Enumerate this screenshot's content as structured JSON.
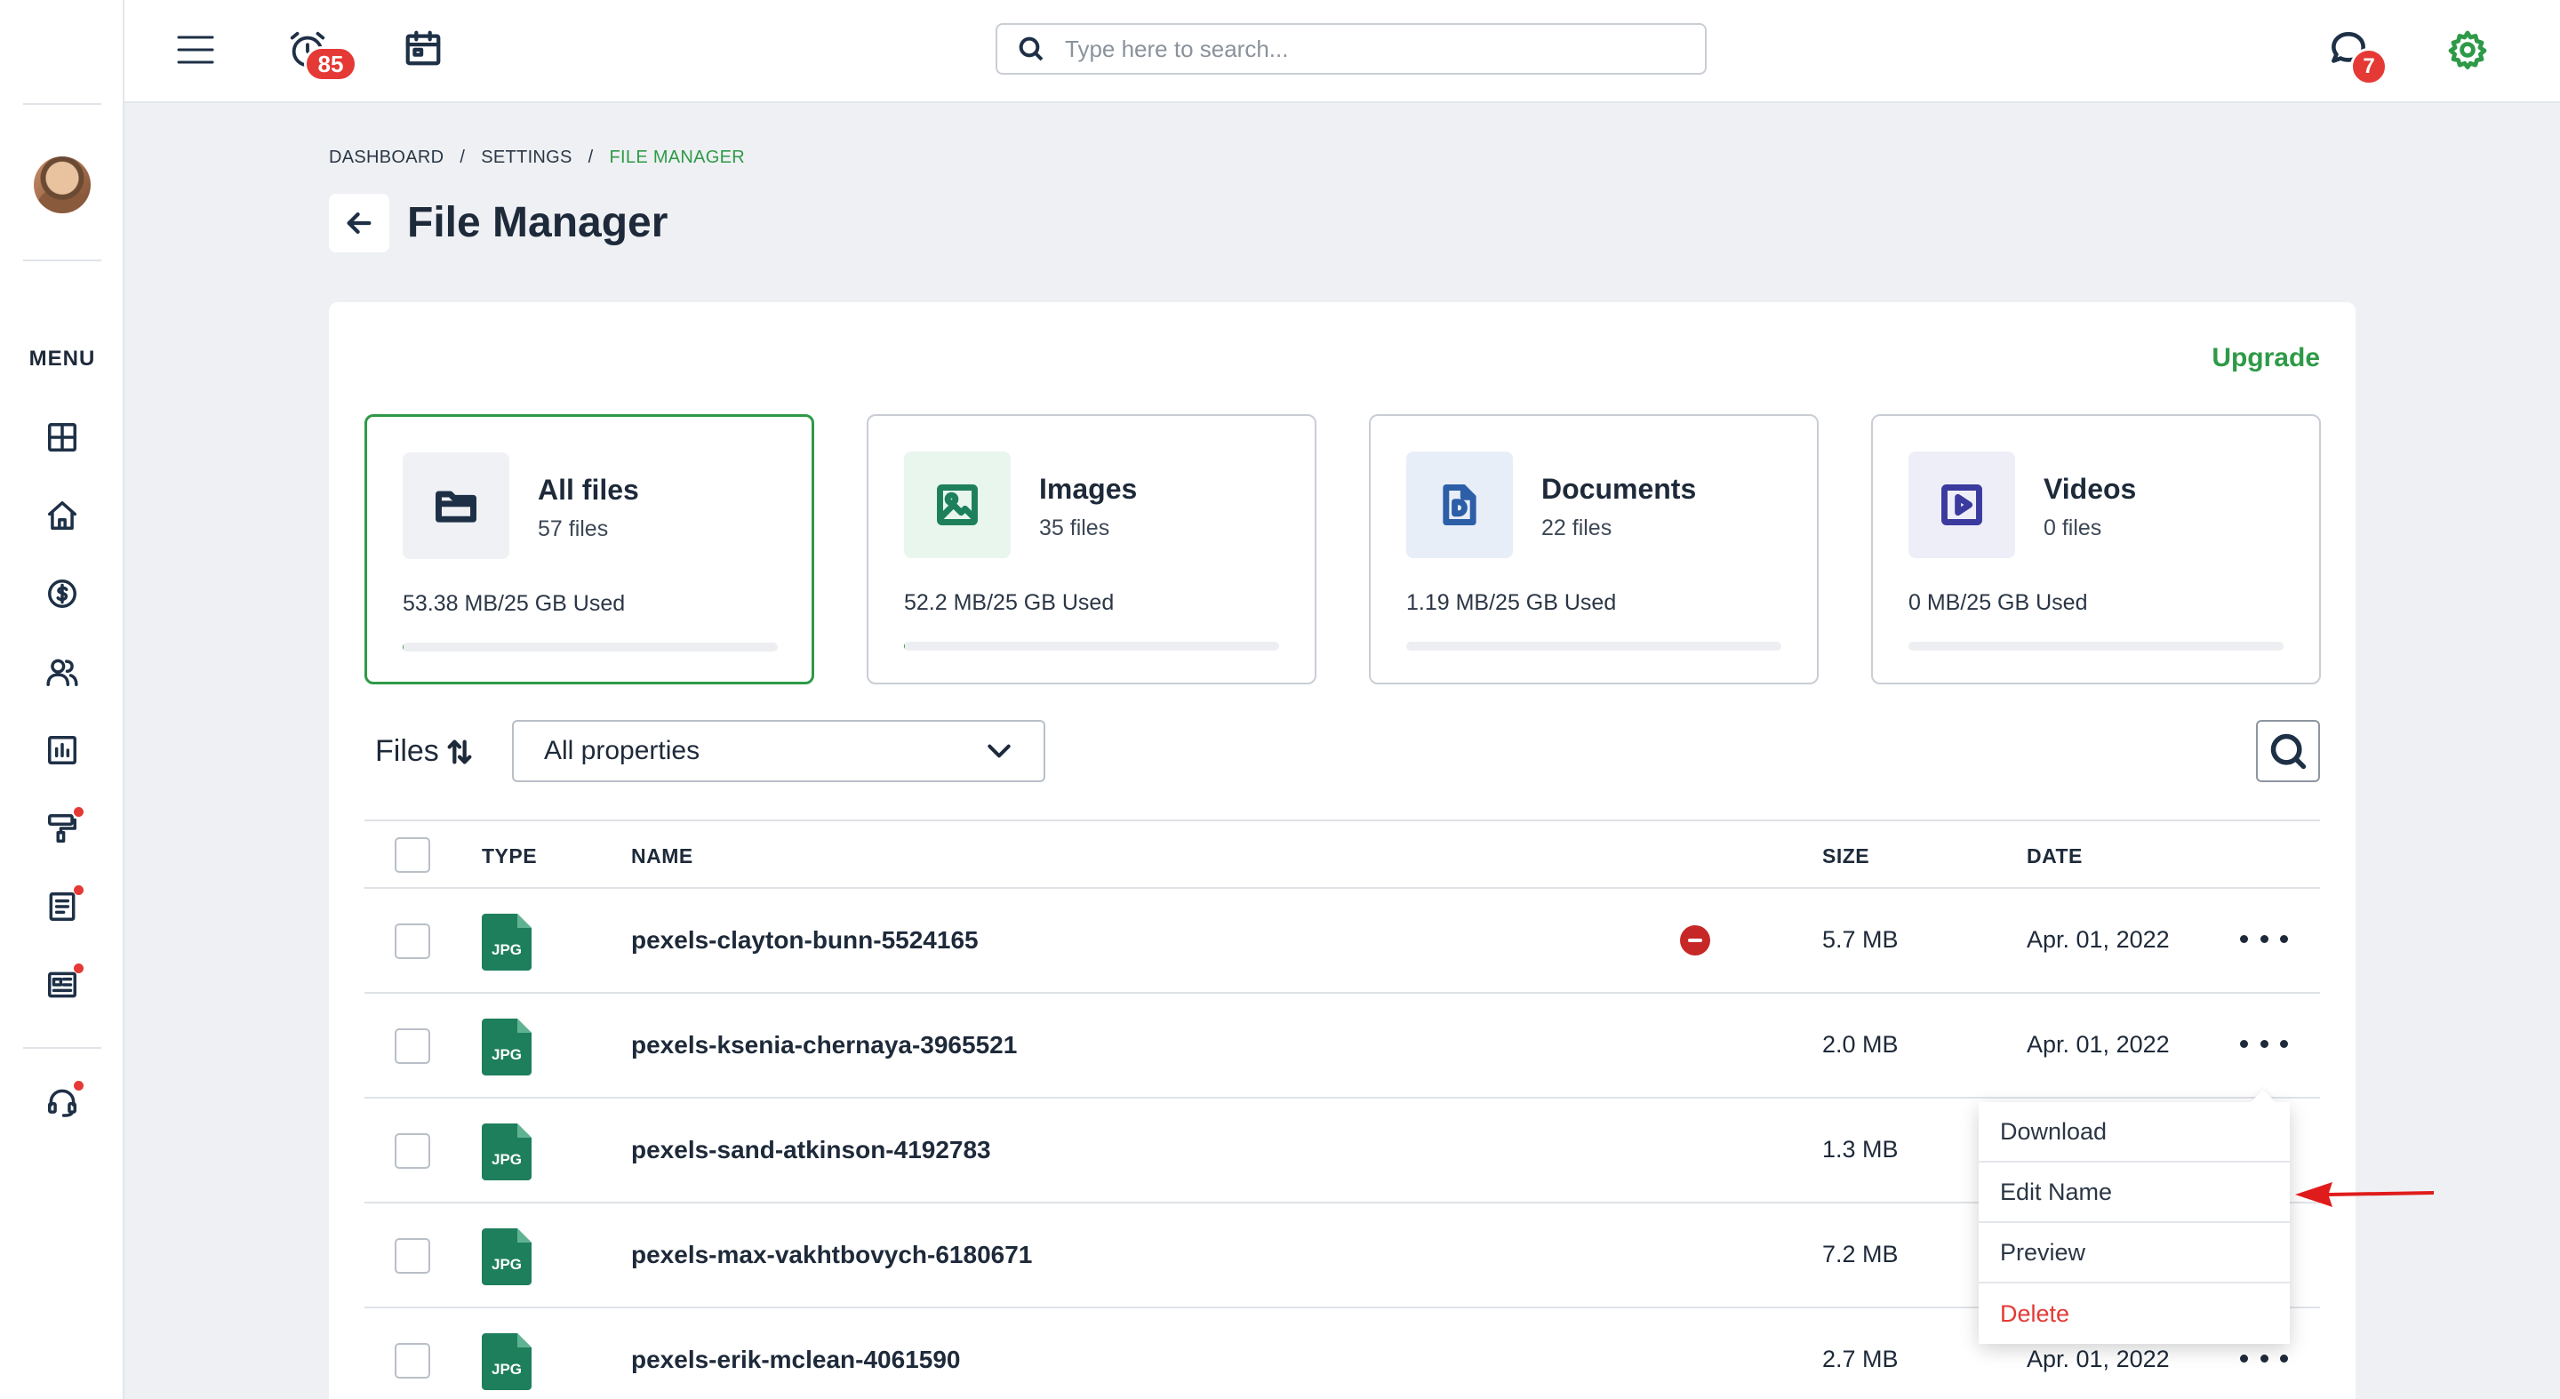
{
  "topbar": {
    "alarm_badge": "85",
    "chat_badge": "7",
    "search_placeholder": "Type here to search..."
  },
  "sidebar": {
    "menu_label": "MENU",
    "items": [
      {
        "icon": "layout-icon",
        "dot": false
      },
      {
        "icon": "home-icon",
        "dot": false
      },
      {
        "icon": "dollar-icon",
        "dot": false
      },
      {
        "icon": "users-icon",
        "dot": false
      },
      {
        "icon": "chart-icon",
        "dot": false
      },
      {
        "icon": "paint-roller-icon",
        "dot": true
      },
      {
        "icon": "document-icon",
        "dot": true
      },
      {
        "icon": "newspaper-icon",
        "dot": true
      },
      {
        "icon": "headset-icon",
        "dot": true
      }
    ]
  },
  "breadcrumb": {
    "items": [
      "DASHBOARD",
      "SETTINGS",
      "FILE MANAGER"
    ],
    "separator": "/"
  },
  "page": {
    "title": "File Manager",
    "upgrade_label": "Upgrade"
  },
  "storage": [
    {
      "title": "All files",
      "count": "57 files",
      "used": "53.38 MB/25 GB Used",
      "fill": 0.002,
      "icon": "folder-icon",
      "selected": true
    },
    {
      "title": "Images",
      "count": "35 files",
      "used": "52.2 MB/25 GB Used",
      "fill": 0.002,
      "icon": "image-icon",
      "selected": false
    },
    {
      "title": "Documents",
      "count": "22 files",
      "used": "1.19 MB/25 GB Used",
      "fill": 0.0,
      "icon": "document-icon",
      "selected": false
    },
    {
      "title": "Videos",
      "count": "0 files",
      "used": "0 MB/25 GB Used",
      "fill": 0.0,
      "icon": "video-icon",
      "selected": false
    }
  ],
  "filter": {
    "files_label": "Files",
    "property_select": "All properties"
  },
  "table": {
    "headers": {
      "type": "TYPE",
      "name": "NAME",
      "size": "SIZE",
      "date": "DATE"
    },
    "rows": [
      {
        "type": "JPG",
        "name": "pexels-clayton-bunn-5524165",
        "size": "5.7 MB",
        "date": "Apr. 01, 2022",
        "status": "blocked"
      },
      {
        "type": "JPG",
        "name": "pexels-ksenia-chernaya-3965521",
        "size": "2.0 MB",
        "date": "Apr. 01, 2022",
        "status": ""
      },
      {
        "type": "JPG",
        "name": "pexels-sand-atkinson-4192783",
        "size": "1.3 MB",
        "date": "",
        "status": ""
      },
      {
        "type": "JPG",
        "name": "pexels-max-vakhtbovych-6180671",
        "size": "7.2 MB",
        "date": "",
        "status": ""
      },
      {
        "type": "JPG",
        "name": "pexels-erik-mclean-4061590",
        "size": "2.7 MB",
        "date": "Apr. 01, 2022",
        "status": ""
      }
    ]
  },
  "context_menu": {
    "items": [
      "Download",
      "Edit Name",
      "Preview",
      "Delete"
    ]
  },
  "colors": {
    "accent": "#2e9a47",
    "danger": "#e53935",
    "text": "#1e2a3a",
    "file_icon": "#1e7f5c"
  }
}
